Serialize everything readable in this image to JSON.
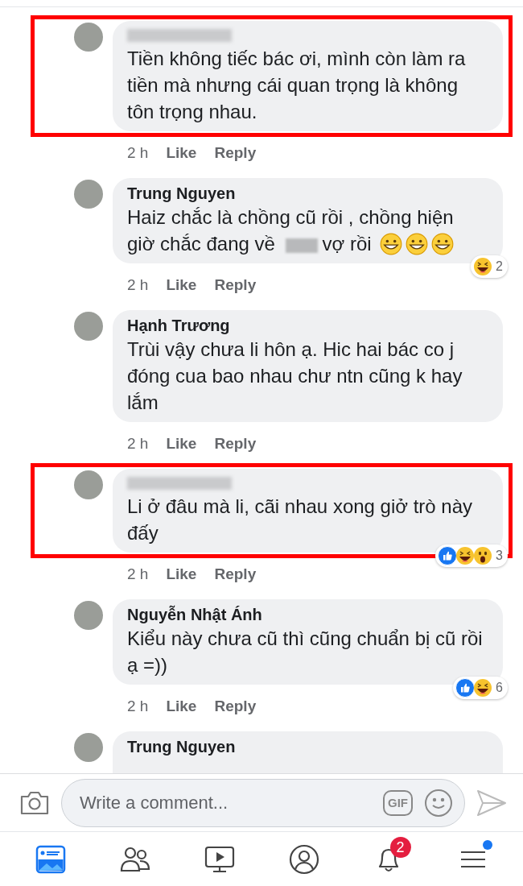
{
  "comments": [
    {
      "author_hidden": true,
      "highlighted": true,
      "body": [
        {
          "kind": "text",
          "text": "Tiền không tiếc bác ơi, mình còn làm ra tiền mà nhưng cái quan trọng là không tôn trọng nhau."
        }
      ],
      "time": "2 h",
      "like": "Like",
      "reply": "Reply"
    },
    {
      "author": "Trung Nguyen",
      "author_hidden": false,
      "highlighted": false,
      "body": [
        {
          "kind": "text",
          "text": "Haiz chắc là chồng cũ rồi , chồng hiện"
        },
        {
          "kind": "text",
          "text": "giờ chắc đang về"
        },
        {
          "kind": "redacted"
        },
        {
          "kind": "text",
          "text": "vợ rồi"
        },
        {
          "kind": "grin"
        },
        {
          "kind": "grin"
        },
        {
          "kind": "grin"
        }
      ],
      "time": "2 h",
      "like": "Like",
      "reply": "Reply",
      "reactions": {
        "kinds": [
          {
            "kind": "haha"
          }
        ],
        "count": "2"
      }
    },
    {
      "author": "Hạnh Trương",
      "author_hidden": false,
      "highlighted": false,
      "body": [
        {
          "kind": "text",
          "text": "Trùi vậy chưa li hôn ạ. Hic hai bác co j đóng cua bao nhau chư ntn cũng k hay lắm"
        }
      ],
      "time": "2 h",
      "like": "Like",
      "reply": "Reply"
    },
    {
      "author_hidden": true,
      "highlighted": true,
      "body": [
        {
          "kind": "text",
          "text": "Li ở đâu mà li, cãi nhau xong giở trò này đấy"
        }
      ],
      "time": "2 h",
      "like": "Like",
      "reply": "Reply",
      "reactions": {
        "kinds": [
          {
            "kind": "like"
          },
          {
            "kind": "haha"
          },
          {
            "kind": "wow"
          }
        ],
        "count": "3"
      }
    },
    {
      "author": "Nguyễn Nhật Ánh",
      "author_hidden": false,
      "highlighted": false,
      "body": [
        {
          "kind": "text",
          "text": "Kiểu này chưa cũ thì cũng chuẩn bị cũ rồi ạ =))"
        }
      ],
      "time": "2 h",
      "like": "Like",
      "reply": "Reply",
      "reactions": {
        "kinds": [
          {
            "kind": "like"
          },
          {
            "kind": "haha"
          }
        ],
        "count": "6"
      }
    },
    {
      "author": "Trung Nguyen",
      "author_hidden": false,
      "highlighted": false
    }
  ],
  "composer": {
    "placeholder": "Write a comment...",
    "gif_label": "GIF"
  },
  "tabs": [
    {
      "kind": "feed",
      "selected": true,
      "dot": false
    },
    {
      "kind": "friends",
      "selected": false,
      "dot": false
    },
    {
      "kind": "watch",
      "selected": false,
      "dot": false
    },
    {
      "kind": "profile",
      "selected": false,
      "dot": false
    },
    {
      "kind": "notifications",
      "selected": false,
      "dot": false,
      "badge": "2"
    },
    {
      "kind": "menu",
      "selected": false,
      "dot": true
    }
  ]
}
